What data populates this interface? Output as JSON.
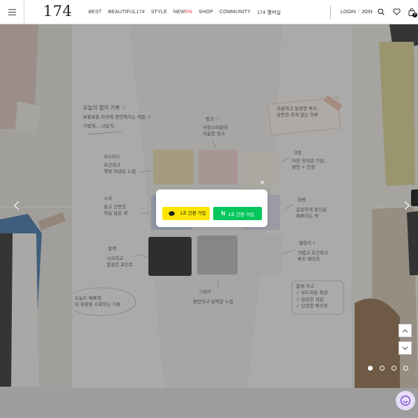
{
  "brand": {
    "logo": "174"
  },
  "nav": {
    "items": [
      "BEST",
      "BEAUTIFUL174",
      "STYLE"
    ],
    "new_label": "NEW",
    "new_accent": "5%",
    "items_after": [
      "SHOP",
      "COMMUNITY",
      "174 멤버십"
    ]
  },
  "account": {
    "login": "LOGIN",
    "sep": "/",
    "join": "JOIN"
  },
  "cart": {
    "count": "0"
  },
  "banner": {
    "notes": {
      "intro": "오늘의 컬러 기록 ♡",
      "intro2": "보들보들 피부에 편안해지는 색들 :)",
      "intro3": "가볍게... 나답게.",
      "mustard": "머스타드",
      "mustard_desc": "포근하고\n햇빛 머금은 느낌",
      "pink": "핑크 ♡",
      "pink_desc": "사랑스러운데\n차분한 핑크",
      "cream": "크림",
      "cream_desc": "어떤 옷이던 기본,\n편안 + 안정",
      "sora": "소라",
      "sora_desc": "맑고 산뜻한\n하늘 닮은 색",
      "lavender": "라벤",
      "lavender_desc": "은은하게 톤다운\n예쁘지는 색",
      "black": "블랙",
      "black_desc": "시크하고\n깔끔한 포인트",
      "melange": "멜란지 !",
      "melange_desc": "가볍고 포근하고\n루즈 에이치",
      "gray": "그레이",
      "gray_desc": "편안하고 담백한 느낌",
      "top_right": "차분하고 말랑한 루즈\n따뜻한 무게 없는 하루",
      "bottom_left": "오늘도 예쁘게\n내 취향을 소화하는 기록",
      "bottom_right": "함께 하고\n✓ 부드러운 촉감\n✓ 은은한 색감\n✓ 단정한 루즈핏"
    }
  },
  "modal": {
    "kakao_label": "1초 간편 가입",
    "naver_n": "N",
    "naver_label": "1초 간편 가입",
    "close": "×"
  },
  "colors": {
    "kakao": "#fee500",
    "naver": "#03c75a",
    "accent_new": "#e83b3b"
  },
  "slider": {
    "dot_count": 4,
    "active_index": 0
  }
}
